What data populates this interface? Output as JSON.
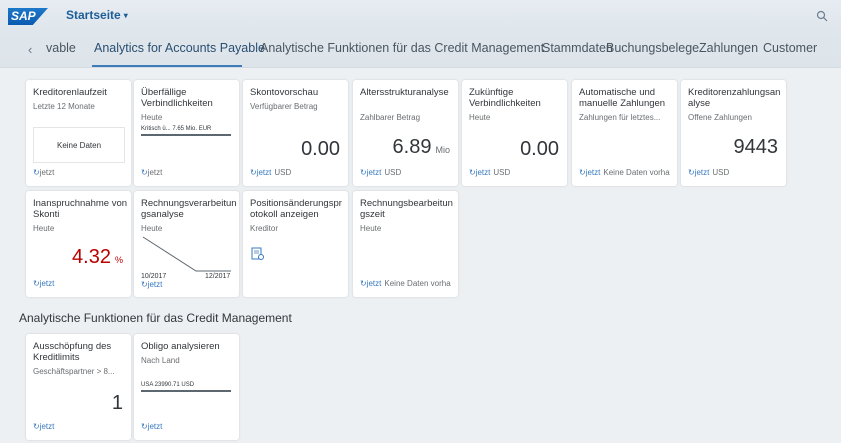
{
  "shell": {
    "logo_text": "SAP",
    "app_title": "Startseite",
    "title_caret": "▾",
    "search_icon": "search-icon"
  },
  "anchor_bar": {
    "back_glyph": "‹",
    "items": [
      {
        "label": "vable"
      },
      {
        "label": "Analytics for Accounts Payable",
        "active": true
      },
      {
        "label": "Analytische Funktionen für das Credit Management"
      },
      {
        "label": "Stammdaten"
      },
      {
        "label": "Buchungsbelege"
      },
      {
        "label": "Zahlungen"
      },
      {
        "label": "Customer"
      }
    ]
  },
  "tiles": [
    {
      "title": "Kreditorenlaufzeit",
      "subtitle": "Letzte 12 Monate",
      "nodata": "Keine Daten",
      "refresh": "jetzt"
    },
    {
      "title": "Überfällige Verbindlichkeiten",
      "subtitle": "Heute",
      "bar_label": "Kritisch ü...   7.65 Mio. EUR",
      "refresh": "jetzt"
    },
    {
      "title": "Skontovorschau",
      "subtitle": "Verfügbarer Betrag",
      "value": "0.00",
      "refresh": "jetzt",
      "unit": "USD"
    },
    {
      "title": "Altersstrukturanalyse",
      "subtitle": "Zahlbarer Betrag",
      "value": "6.89",
      "value_unit": "Mio",
      "refresh": "jetzt",
      "unit": "USD"
    },
    {
      "title": "Zukünftige Verbindlichkeiten",
      "subtitle": "Heute",
      "value": "0.00",
      "refresh": "jetzt",
      "unit": "USD"
    },
    {
      "title": "Automatische und manuelle Zahlungen",
      "subtitle": "Zahlungen für letztes...",
      "refresh": "jetzt",
      "unit": "Keine Daten vorha"
    },
    {
      "title": "Kreditorenzahlungsanalyse",
      "subtitle": "Offene Zahlungen",
      "value": "9443",
      "refresh": "jetzt",
      "unit": "USD"
    },
    {
      "title": "Inanspruchnahme von Skonti",
      "subtitle": "Heute",
      "value": "4.32",
      "value_unit": "%",
      "value_color": "#bb0000",
      "refresh": "jetzt"
    },
    {
      "title": "Rechnungsverarbeitungsanalyse",
      "subtitle": "Heute",
      "tick_start": "10/2017",
      "tick_end": "12/2017",
      "refresh": "jetzt"
    },
    {
      "title": "Positionsänderungsprotokoll anzeigen",
      "subtitle": "Kreditor",
      "icon": "document-list-icon"
    },
    {
      "title": "Rechnungsbearbeitungszeit",
      "subtitle": "Heute",
      "refresh": "jetzt",
      "unit": "Keine Daten vorha"
    },
    {
      "title": "Ausschöpfung des Kreditlimits",
      "subtitle": "Geschäftspartner > 8...",
      "value": "1",
      "refresh": "jetzt"
    },
    {
      "title": "Obligo analysieren",
      "subtitle": "Nach Land",
      "bar_label": "USA        23990.71 USD",
      "refresh": "jetzt"
    }
  ],
  "section": {
    "title": "Analytische Funktionen für das Credit Management"
  },
  "colors": {
    "accent": "#3778c1",
    "critical": "#bb0000"
  }
}
